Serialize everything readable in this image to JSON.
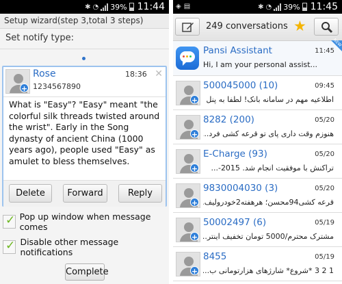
{
  "left_screen": {
    "status_bar": {
      "battery": "39%",
      "time": "11:44"
    },
    "wizard_title": "Setup wizard(step 3,total 3 steps)",
    "notify_label": "Set notify type:",
    "popup": {
      "sender_name": "Rose",
      "sender_number": "1234567890",
      "time": "18:36",
      "message": "What is \"Easy\"? \"Easy\" meant \"the colorful silk threads twisted around the wrist\". Early in the Song dynasty of ancient China (1000 years ago), people used \"Easy\" as amulet to bless themselves.",
      "buttons": {
        "delete": "Delete",
        "forward": "Forward",
        "reply": "Reply"
      }
    },
    "options": [
      {
        "label": "Pop up window when message comes",
        "checked": true
      },
      {
        "label": "Disable other message notifications",
        "checked": true
      }
    ],
    "complete_label": "Complete"
  },
  "right_screen": {
    "status_bar": {
      "battery": "39%",
      "time": "11:45"
    },
    "conversation_count": "249 conversations",
    "new_badge": "NEW",
    "conversations": [
      {
        "name": "Pansi Assistant",
        "time": "11:45",
        "snippet": "Hi, I am your personal assist..."
      },
      {
        "name": "500045000 (10)",
        "time": "09:45",
        "snippet": "اطلاعیه مهم در سامانه بانک! لطفا به پنل ..."
      },
      {
        "name": "8282 (200)",
        "time": "05/20",
        "snippet": "هنوزم وقت داری پای تو قرعه کشی فرد..."
      },
      {
        "name": "E-Charge (93)",
        "time": "05/20",
        "snippet": "تراکنش با موفقیت انجام شد. 2015-..."
      },
      {
        "name": "9830004030 (3)",
        "time": "05/20",
        "snippet": "قرعه کشی94محسن؛ هرهفته2خودرولیف..."
      },
      {
        "name": "50002497 (6)",
        "time": "05/19",
        "snippet": "مشترک محترم/5000 تومان تخفیف اینتر..."
      },
      {
        "name": "8455",
        "time": "05/19",
        "snippet": "1 2 3 *شروع* شارژهای هزارتومانی ب..."
      }
    ],
    "colors": {
      "accent": "#2a6cc4",
      "star": "#f4b400",
      "check": "#6cb61f",
      "assistant": "#1c6cd6"
    }
  }
}
